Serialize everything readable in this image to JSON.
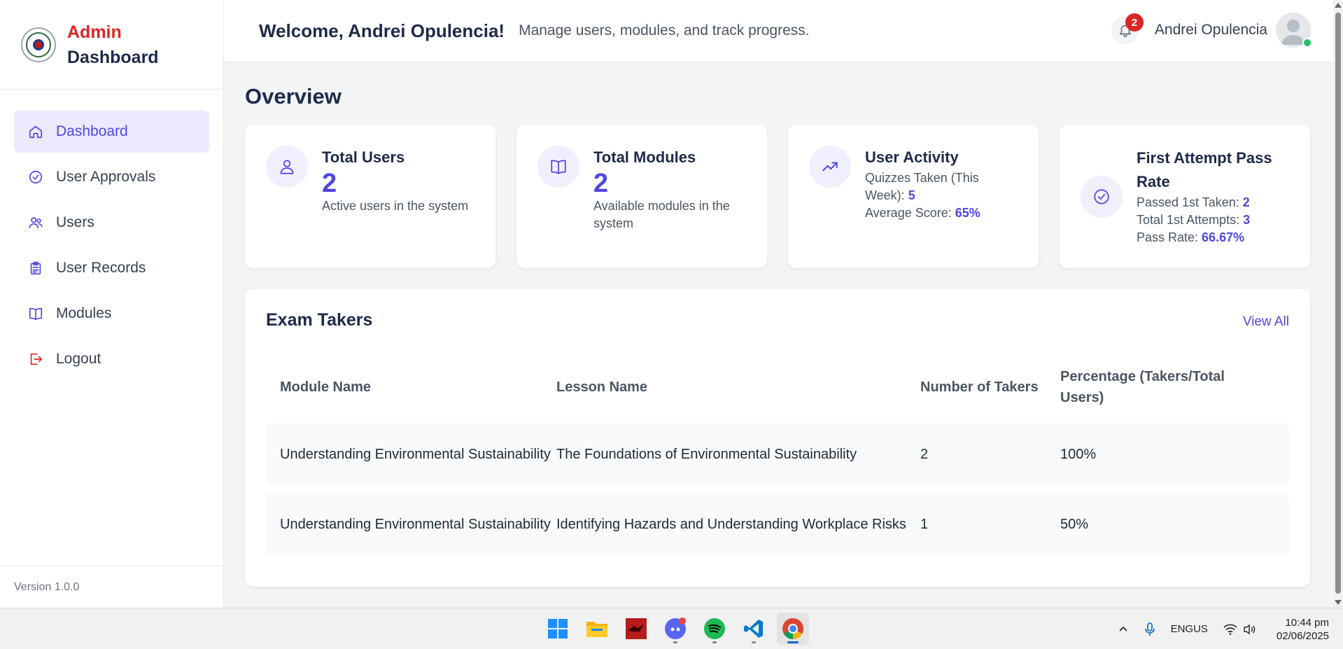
{
  "brand": {
    "line1": "Admin",
    "line2": "Dashboard"
  },
  "sidebar": {
    "items": [
      {
        "label": "Dashboard",
        "icon": "home-icon",
        "active": true
      },
      {
        "label": "User Approvals",
        "icon": "check-circle-icon"
      },
      {
        "label": "Users",
        "icon": "users-icon"
      },
      {
        "label": "User Records",
        "icon": "records-icon"
      },
      {
        "label": "Modules",
        "icon": "book-icon"
      },
      {
        "label": "Logout",
        "icon": "logout-icon"
      }
    ],
    "version": "Version 1.0.0"
  },
  "header": {
    "welcome": "Welcome, Andrei Opulencia!",
    "subtitle": "Manage users, modules, and track progress.",
    "notifications": "2",
    "user_name": "Andrei Opulencia"
  },
  "overview": {
    "title": "Overview",
    "total_users": {
      "title": "Total Users",
      "value": "2",
      "desc": "Active users in the system"
    },
    "total_modules": {
      "title": "Total Modules",
      "value": "2",
      "desc": "Available modules in the system"
    },
    "user_activity": {
      "title": "User Activity",
      "quizzes_label": "Quizzes Taken (This Week): ",
      "quizzes_value": "5",
      "avg_label": "Average Score: ",
      "avg_value": "65%"
    },
    "pass_rate": {
      "title": "First Attempt Pass Rate",
      "passed_label": "Passed 1st Taken: ",
      "passed_value": "2",
      "attempts_label": "Total 1st Attempts: ",
      "attempts_value": "3",
      "rate_label": "Pass Rate: ",
      "rate_value": "66.67%"
    }
  },
  "exam_takers": {
    "title": "Exam Takers",
    "view_all": "View All",
    "columns": [
      "Module Name",
      "Lesson Name",
      "Number of Takers",
      "Percentage (Takers/Total Users)"
    ],
    "rows": [
      [
        "Understanding Environmental Sustainability",
        "The Foundations of Environmental Sustainability",
        "2",
        "100%"
      ],
      [
        "Understanding Environmental Sustainability",
        "Identifying Hazards and Understanding Workplace Risks",
        "1",
        "50%"
      ]
    ]
  },
  "taskbar": {
    "apps": [
      "windows-start-icon",
      "file-explorer-icon",
      "game-app-icon",
      "discord-icon",
      "spotify-icon",
      "vscode-icon",
      "chrome-icon"
    ],
    "lang_line1": "ENG",
    "lang_line2": "US",
    "time": "10:44 pm",
    "date": "02/06/2025"
  },
  "colors": {
    "accent": "#4f46e5",
    "brand_red": "#dc2626",
    "active_bg": "#ede9fe"
  }
}
